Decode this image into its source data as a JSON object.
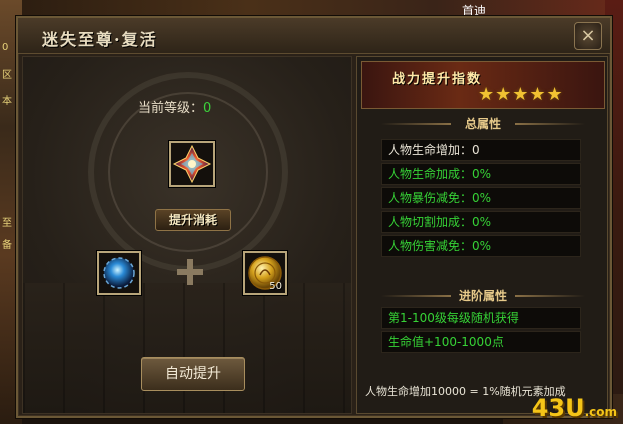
{
  "window": {
    "title": "迷失至尊·复活",
    "close_symbol": "×"
  },
  "side": {
    "left_tags": [
      "0",
      "区",
      "本",
      "至",
      "备"
    ],
    "top_right": "首迪"
  },
  "upgrade": {
    "level_label": "当前等级：",
    "level_value": "0",
    "consume_label": "提升消耗",
    "main_item_icon": "crystal-gem-icon",
    "material_left_icon": "blue-orb-icon",
    "material_right_icon": "gold-coin-icon",
    "material_right_count": "50",
    "plus_icon": "plus-icon",
    "auto_button": "自动提升"
  },
  "power": {
    "title": "战力提升指数",
    "stars": "★★★★★",
    "star_count": 5,
    "star_color": "#f1c232"
  },
  "total_attributes": {
    "heading": "总属性",
    "rows": [
      {
        "text": "人物生命增加：0",
        "color": "white"
      },
      {
        "text": "人物生命加成：0%",
        "color": "green"
      },
      {
        "text": "人物暴伤减免：0%",
        "color": "green"
      },
      {
        "text": "人物切割加成：0%",
        "color": "green"
      },
      {
        "text": "人物伤害减免：0%",
        "color": "green"
      }
    ]
  },
  "advanced_attributes": {
    "heading": "进阶属性",
    "rows": [
      {
        "text": "第1-100级每级随机获得",
        "color": "green"
      },
      {
        "text": "生命值+100-1000点",
        "color": "green"
      }
    ]
  },
  "note": "人物生命增加10000 = 1%随机元素加成",
  "watermark": {
    "main": "43U",
    "suffix": ".com"
  }
}
